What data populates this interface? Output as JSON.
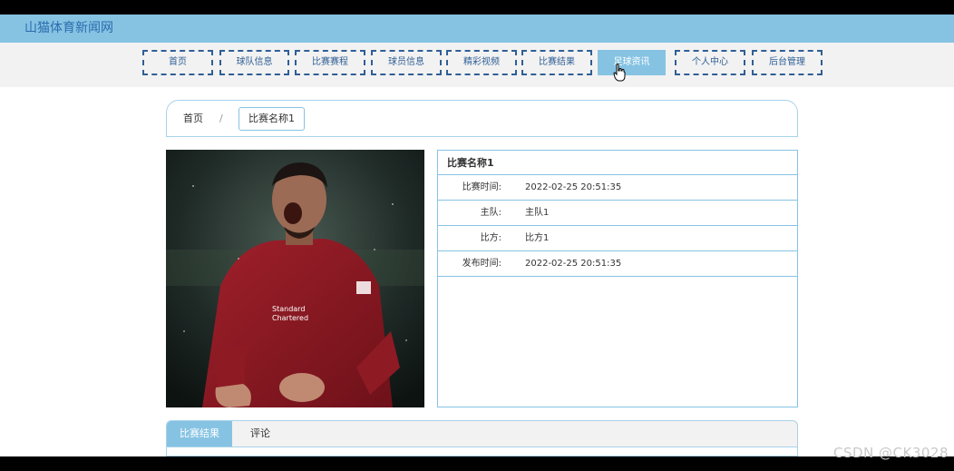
{
  "site": {
    "title": "山猫体育新闻网"
  },
  "nav": {
    "items": [
      {
        "label": "首页"
      },
      {
        "label": "球队信息"
      },
      {
        "label": "比赛赛程"
      },
      {
        "label": "球员信息"
      },
      {
        "label": "精彩视频"
      },
      {
        "label": "比赛结果"
      },
      {
        "label": "足球资讯",
        "active": true
      },
      {
        "label": "个人中心"
      },
      {
        "label": "后台管理"
      }
    ]
  },
  "breadcrumb": {
    "home": "首页",
    "separator": "/",
    "current": "比赛名称1"
  },
  "detail": {
    "title": "比赛名称1",
    "rows": [
      {
        "label": "比赛时间:",
        "value": "2022-02-25 20:51:35"
      },
      {
        "label": "主队:",
        "value": "主队1"
      },
      {
        "label": "比方:",
        "value": "比方1"
      },
      {
        "label": "发布时间:",
        "value": "2022-02-25 20:51:35"
      }
    ]
  },
  "tabs": {
    "result": "比赛结果",
    "comments": "评论"
  },
  "watermark": "CSDN @CK3028",
  "colors": {
    "accent": "#86c3e3",
    "nav_border": "#2f5f95",
    "photo_shirt": "#8b1a22"
  }
}
